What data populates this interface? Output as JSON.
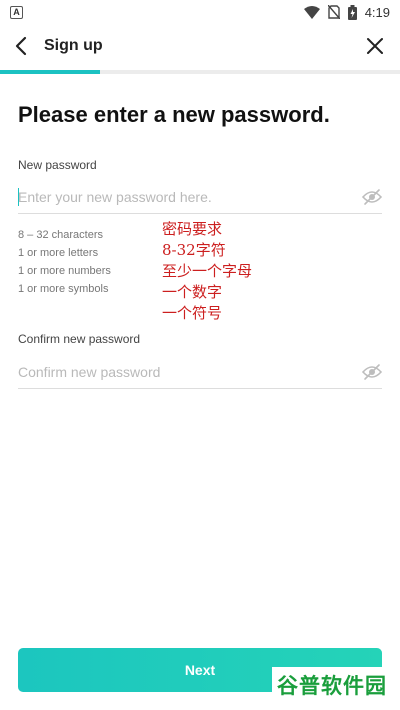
{
  "status_bar": {
    "time": "4:19",
    "app_icon_letter": "A"
  },
  "header": {
    "title": "Sign up"
  },
  "progress": {
    "fraction": 0.25
  },
  "main": {
    "heading": "Please enter a new password.",
    "new_password": {
      "label": "New password",
      "placeholder": "Enter your new password here."
    },
    "rules": [
      "8 – 32 characters",
      "1 or more letters",
      "1 or more numbers",
      "1 or more symbols"
    ],
    "confirm_password": {
      "label": "Confirm new password",
      "placeholder": "Confirm new password"
    },
    "next_label": "Next"
  },
  "annotation": [
    "密码要求",
    "8-32字符",
    "至少一个字母",
    "一个数字",
    "一个符号"
  ],
  "watermark": "谷普软件园",
  "colors": {
    "accent": "#1cc2c2",
    "annotation": "#cc1f1f",
    "watermark": "#1a9e3c"
  },
  "icons": [
    "back-arrow-icon",
    "close-icon",
    "eye-hidden-icon",
    "wifi-icon",
    "no-sim-icon",
    "battery-icon"
  ]
}
